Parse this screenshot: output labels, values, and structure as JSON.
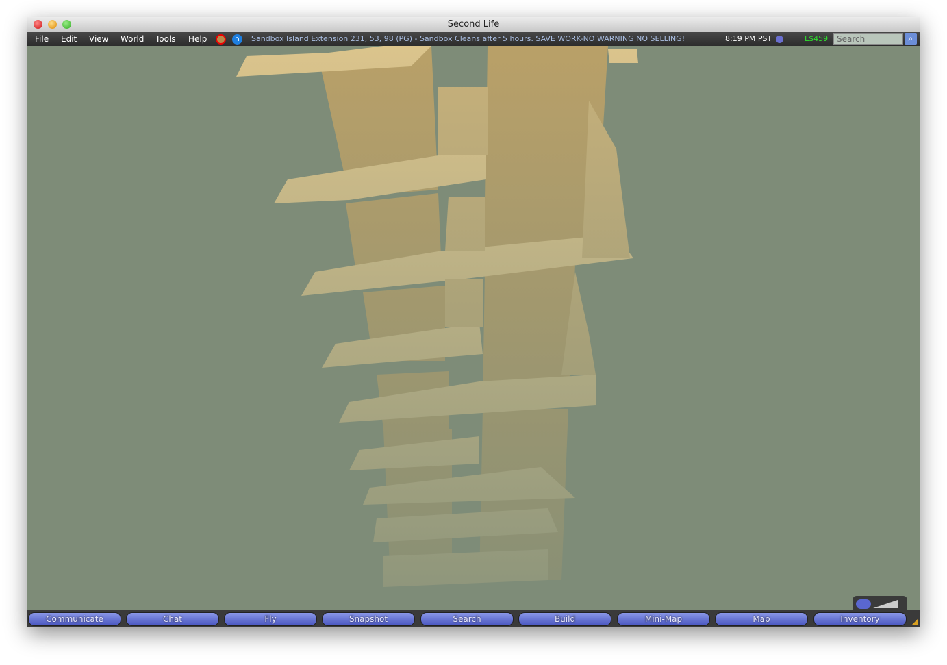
{
  "window": {
    "title": "Second Life"
  },
  "menu": {
    "items": [
      "File",
      "Edit",
      "View",
      "World",
      "Tools",
      "Help"
    ]
  },
  "status": {
    "location": "Sandbox Island Extension 231, 53, 98 (PG) - Sandbox Cleans after 5 hours. SAVE WORK-NO WARNING NO SELLING!",
    "time": "8:19 PM PST",
    "balance": "L$459",
    "search_placeholder": "Search",
    "icons": [
      "no-build-icon",
      "voice-icon",
      "currency-icon",
      "search-icon"
    ]
  },
  "toolbar": {
    "buttons": [
      "Communicate",
      "Chat",
      "Fly",
      "Snapshot",
      "Search",
      "Build",
      "Mini-Map",
      "Map",
      "Inventory"
    ]
  },
  "colors": {
    "sky": "#7e8c78",
    "wood": "#d9c48f",
    "button": "#5a67d0",
    "balance": "#2ee02e"
  }
}
